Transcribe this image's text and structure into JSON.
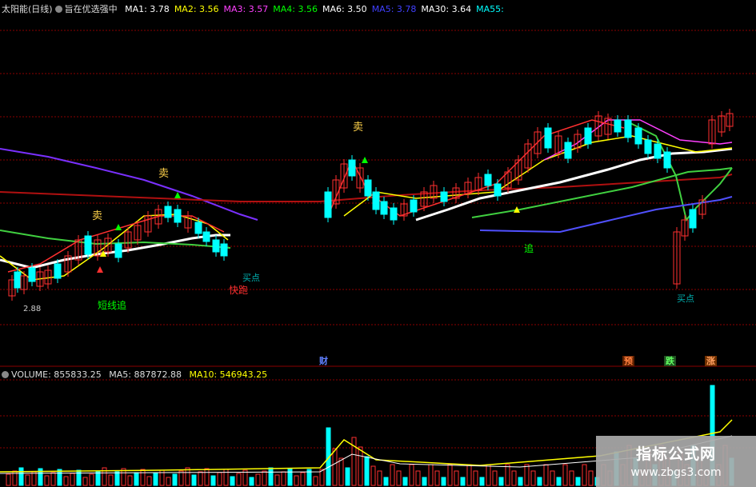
{
  "main_header": {
    "indicator_name": "太阳能(日线)",
    "formula_name": "旨在优选强中",
    "ma": [
      {
        "label": "MA1: 3.78",
        "color": "#ffffff"
      },
      {
        "label": "MA2: 3.56",
        "color": "#ffff00"
      },
      {
        "label": "MA3: 3.57",
        "color": "#ff40ff"
      },
      {
        "label": "MA4: 3.56",
        "color": "#00ff00"
      },
      {
        "label": "MA6: 3.50",
        "color": "#ffffff"
      },
      {
        "label": "MA5: 3.78",
        "color": "#4040ff"
      },
      {
        "label": "MA30: 3.64",
        "color": "#ffffff"
      },
      {
        "label": "MA55:",
        "color": "#00ffff"
      }
    ]
  },
  "volume_header": {
    "volume": "VOLUME: 855833.25",
    "ma5": "MA5: 887872.88",
    "ma10": "MA10: 546943.25"
  },
  "signals": {
    "sell1": "卖",
    "sell2": "卖",
    "sell3": "卖",
    "short_chase": "短线追",
    "buy_point1": "买点",
    "buy_point2": "买点",
    "fast_run": "快跑",
    "chase": "追"
  },
  "price_low_label": "2.88",
  "event_tags": {
    "cai": "财",
    "yu": "预",
    "die": "跌",
    "zhang": "涨"
  },
  "watermark": {
    "line1": "指标公式网",
    "line2": "www.zbgs3.com"
  },
  "colors": {
    "up": "#ff3030",
    "down": "#00ffff",
    "background": "#000000",
    "grid": "#8b0000"
  }
}
